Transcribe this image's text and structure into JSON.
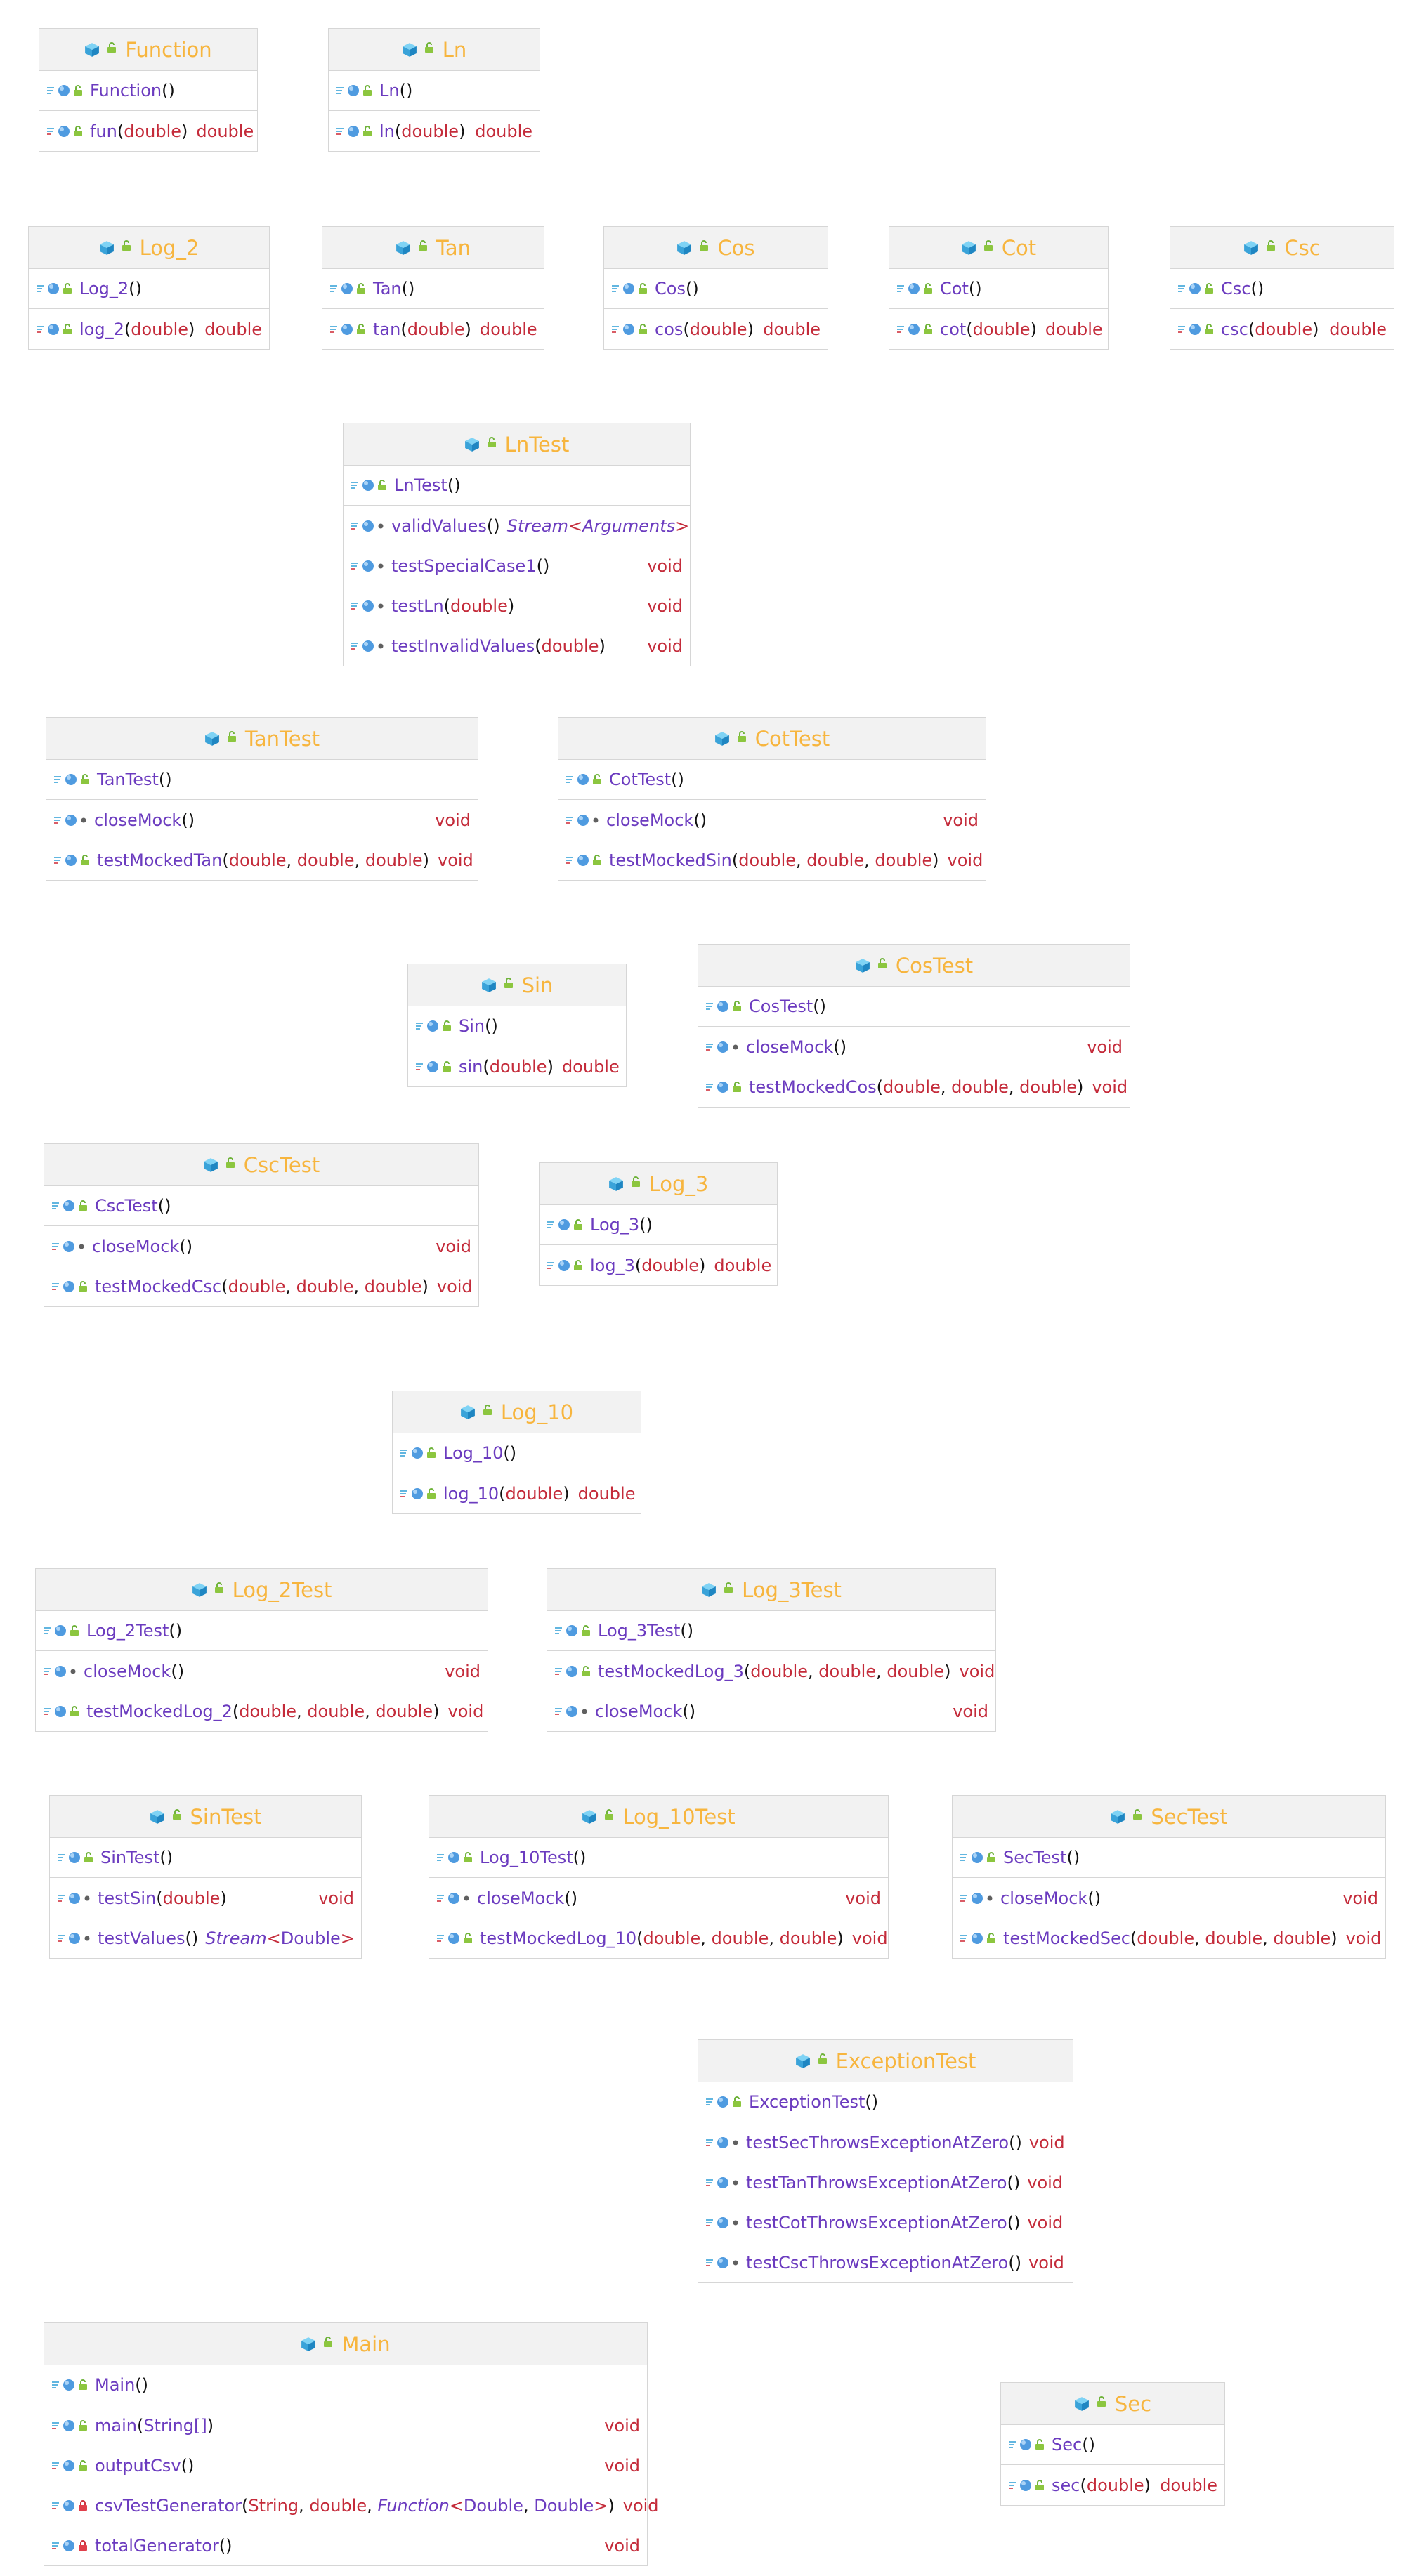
{
  "colors": {
    "class_name": "#f7b53e",
    "method": "#6b3bbf",
    "type": "#c42b3a",
    "header_bg": "#f2f2f2",
    "border": "#d6d6d6"
  },
  "classes": [
    {
      "name": "Function",
      "members": [
        {
          "name": "Function",
          "params": [],
          "ret": "",
          "kind": "ctor",
          "vis": "public"
        },
        {
          "name": "fun",
          "params": [
            {
              "t": "double"
            }
          ],
          "ret": "double",
          "kind": "method",
          "vis": "public"
        }
      ]
    },
    {
      "name": "Ln",
      "members": [
        {
          "name": "Ln",
          "params": [],
          "ret": "",
          "kind": "ctor",
          "vis": "public"
        },
        {
          "name": "ln",
          "params": [
            {
              "t": "double"
            }
          ],
          "ret": "double",
          "kind": "method",
          "vis": "public"
        }
      ]
    },
    {
      "name": "Log_2",
      "members": [
        {
          "name": "Log_2",
          "params": [],
          "ret": "",
          "kind": "ctor",
          "vis": "public"
        },
        {
          "name": "log_2",
          "params": [
            {
              "t": "double"
            }
          ],
          "ret": "double",
          "kind": "method",
          "vis": "public"
        }
      ]
    },
    {
      "name": "Tan",
      "members": [
        {
          "name": "Tan",
          "params": [],
          "ret": "",
          "kind": "ctor",
          "vis": "public"
        },
        {
          "name": "tan",
          "params": [
            {
              "t": "double"
            }
          ],
          "ret": "double",
          "kind": "method",
          "vis": "public"
        }
      ]
    },
    {
      "name": "Cos",
      "members": [
        {
          "name": "Cos",
          "params": [],
          "ret": "",
          "kind": "ctor",
          "vis": "public"
        },
        {
          "name": "cos",
          "params": [
            {
              "t": "double"
            }
          ],
          "ret": "double",
          "kind": "method",
          "vis": "public"
        }
      ]
    },
    {
      "name": "Cot",
      "members": [
        {
          "name": "Cot",
          "params": [],
          "ret": "",
          "kind": "ctor",
          "vis": "public"
        },
        {
          "name": "cot",
          "params": [
            {
              "t": "double"
            }
          ],
          "ret": "double",
          "kind": "method",
          "vis": "public"
        }
      ]
    },
    {
      "name": "Csc",
      "members": [
        {
          "name": "Csc",
          "params": [],
          "ret": "",
          "kind": "ctor",
          "vis": "public"
        },
        {
          "name": "csc",
          "params": [
            {
              "t": "double"
            }
          ],
          "ret": "double",
          "kind": "method",
          "vis": "public"
        }
      ]
    },
    {
      "name": "LnTest",
      "members": [
        {
          "name": "LnTest",
          "params": [],
          "ret": "",
          "kind": "ctor",
          "vis": "public"
        },
        {
          "name": "validValues",
          "params": [],
          "retParts": [
            {
              "t": "Stream",
              "s": "i"
            },
            {
              "t": "<",
              "s": "r"
            },
            {
              "t": "Arguments",
              "s": "i"
            },
            {
              "t": ">",
              "s": "r"
            }
          ],
          "ret": "",
          "inline": true,
          "kind": "method",
          "vis": "package"
        },
        {
          "name": "testSpecialCase1",
          "params": [],
          "ret": "void",
          "kind": "method",
          "vis": "package"
        },
        {
          "name": "testLn",
          "params": [
            {
              "t": "double"
            }
          ],
          "ret": "void",
          "kind": "method",
          "vis": "package"
        },
        {
          "name": "testInvalidValues",
          "params": [
            {
              "t": "double"
            }
          ],
          "ret": "void",
          "kind": "method",
          "vis": "package"
        }
      ]
    },
    {
      "name": "TanTest",
      "members": [
        {
          "name": "TanTest",
          "params": [],
          "ret": "",
          "kind": "ctor",
          "vis": "public"
        },
        {
          "name": "closeMock",
          "params": [],
          "ret": "void",
          "kind": "method",
          "vis": "package"
        },
        {
          "name": "testMockedTan",
          "params": [
            {
              "t": "double"
            },
            {
              "t": "double"
            },
            {
              "t": "double"
            }
          ],
          "ret": "void",
          "kind": "method",
          "vis": "public"
        }
      ]
    },
    {
      "name": "CotTest",
      "members": [
        {
          "name": "CotTest",
          "params": [],
          "ret": "",
          "kind": "ctor",
          "vis": "public"
        },
        {
          "name": "closeMock",
          "params": [],
          "ret": "void",
          "kind": "method",
          "vis": "package"
        },
        {
          "name": "testMockedSin",
          "params": [
            {
              "t": "double"
            },
            {
              "t": "double"
            },
            {
              "t": "double"
            }
          ],
          "ret": "void",
          "kind": "method",
          "vis": "public"
        }
      ]
    },
    {
      "name": "Sin",
      "members": [
        {
          "name": "Sin",
          "params": [],
          "ret": "",
          "kind": "ctor",
          "vis": "public"
        },
        {
          "name": "sin",
          "params": [
            {
              "t": "double"
            }
          ],
          "ret": "double",
          "kind": "method",
          "vis": "public"
        }
      ]
    },
    {
      "name": "CosTest",
      "members": [
        {
          "name": "CosTest",
          "params": [],
          "ret": "",
          "kind": "ctor",
          "vis": "public"
        },
        {
          "name": "closeMock",
          "params": [],
          "ret": "void",
          "kind": "method",
          "vis": "package"
        },
        {
          "name": "testMockedCos",
          "params": [
            {
              "t": "double"
            },
            {
              "t": "double"
            },
            {
              "t": "double"
            }
          ],
          "ret": "void",
          "kind": "method",
          "vis": "public"
        }
      ]
    },
    {
      "name": "CscTest",
      "members": [
        {
          "name": "CscTest",
          "params": [],
          "ret": "",
          "kind": "ctor",
          "vis": "public"
        },
        {
          "name": "closeMock",
          "params": [],
          "ret": "void",
          "kind": "method",
          "vis": "package"
        },
        {
          "name": "testMockedCsc",
          "params": [
            {
              "t": "double"
            },
            {
              "t": "double"
            },
            {
              "t": "double"
            }
          ],
          "ret": "void",
          "kind": "method",
          "vis": "public"
        }
      ]
    },
    {
      "name": "Log_3",
      "members": [
        {
          "name": "Log_3",
          "params": [],
          "ret": "",
          "kind": "ctor",
          "vis": "public"
        },
        {
          "name": "log_3",
          "params": [
            {
              "t": "double"
            }
          ],
          "ret": "double",
          "kind": "method",
          "vis": "public"
        }
      ]
    },
    {
      "name": "Log_10",
      "members": [
        {
          "name": "Log_10",
          "params": [],
          "ret": "",
          "kind": "ctor",
          "vis": "public"
        },
        {
          "name": "log_10",
          "params": [
            {
              "t": "double"
            }
          ],
          "ret": "double",
          "kind": "method",
          "vis": "public"
        }
      ]
    },
    {
      "name": "Log_2Test",
      "members": [
        {
          "name": "Log_2Test",
          "params": [],
          "ret": "",
          "kind": "ctor",
          "vis": "public"
        },
        {
          "name": "closeMock",
          "params": [],
          "ret": "void",
          "kind": "method",
          "vis": "package"
        },
        {
          "name": "testMockedLog_2",
          "params": [
            {
              "t": "double"
            },
            {
              "t": "double"
            },
            {
              "t": "double"
            }
          ],
          "ret": "void",
          "kind": "method",
          "vis": "public"
        }
      ]
    },
    {
      "name": "Log_3Test",
      "members": [
        {
          "name": "Log_3Test",
          "params": [],
          "ret": "",
          "kind": "ctor",
          "vis": "public"
        },
        {
          "name": "testMockedLog_3",
          "params": [
            {
              "t": "double"
            },
            {
              "t": "double"
            },
            {
              "t": "double"
            }
          ],
          "ret": "void",
          "kind": "method",
          "vis": "public"
        },
        {
          "name": "closeMock",
          "params": [],
          "ret": "void",
          "kind": "method",
          "vis": "package"
        }
      ]
    },
    {
      "name": "SinTest",
      "members": [
        {
          "name": "SinTest",
          "params": [],
          "ret": "",
          "kind": "ctor",
          "vis": "public"
        },
        {
          "name": "testSin",
          "params": [
            {
              "t": "double"
            }
          ],
          "ret": "void",
          "kind": "method",
          "vis": "package"
        },
        {
          "name": "testValues",
          "params": [],
          "retParts": [
            {
              "t": "Stream",
              "s": "i"
            },
            {
              "t": "<",
              "s": "r"
            },
            {
              "t": "Double",
              "s": "m"
            },
            {
              "t": ">",
              "s": "r"
            }
          ],
          "ret": "",
          "inline": true,
          "kind": "method",
          "vis": "package"
        }
      ]
    },
    {
      "name": "Log_10Test",
      "members": [
        {
          "name": "Log_10Test",
          "params": [],
          "ret": "",
          "kind": "ctor",
          "vis": "public"
        },
        {
          "name": "closeMock",
          "params": [],
          "ret": "void",
          "kind": "method",
          "vis": "package"
        },
        {
          "name": "testMockedLog_10",
          "params": [
            {
              "t": "double"
            },
            {
              "t": "double"
            },
            {
              "t": "double"
            }
          ],
          "ret": "void",
          "kind": "method",
          "vis": "public"
        }
      ]
    },
    {
      "name": "SecTest",
      "members": [
        {
          "name": "SecTest",
          "params": [],
          "ret": "",
          "kind": "ctor",
          "vis": "public"
        },
        {
          "name": "closeMock",
          "params": [],
          "ret": "void",
          "kind": "method",
          "vis": "package"
        },
        {
          "name": "testMockedSec",
          "params": [
            {
              "t": "double"
            },
            {
              "t": "double"
            },
            {
              "t": "double"
            }
          ],
          "ret": "void",
          "kind": "method",
          "vis": "public"
        }
      ]
    },
    {
      "name": "ExceptionTest",
      "members": [
        {
          "name": "ExceptionTest",
          "params": [],
          "ret": "",
          "kind": "ctor",
          "vis": "public"
        },
        {
          "name": "testSecThrowsExceptionAtZero",
          "params": [],
          "ret": "void",
          "inline": true,
          "kind": "method",
          "vis": "package"
        },
        {
          "name": "testTanThrowsExceptionAtZero",
          "params": [],
          "ret": "void",
          "inline": true,
          "kind": "method",
          "vis": "package"
        },
        {
          "name": "testCotThrowsExceptionAtZero",
          "params": [],
          "ret": "void",
          "inline": true,
          "kind": "method",
          "vis": "package"
        },
        {
          "name": "testCscThrowsExceptionAtZero",
          "params": [],
          "ret": "void",
          "inline": true,
          "kind": "method",
          "vis": "package"
        }
      ]
    },
    {
      "name": "Main",
      "members": [
        {
          "name": "Main",
          "params": [],
          "ret": "",
          "kind": "ctor",
          "vis": "public"
        },
        {
          "name": "main",
          "params": [
            {
              "t": "String[]",
              "plain": true
            }
          ],
          "ret": "void",
          "kind": "method",
          "vis": "public"
        },
        {
          "name": "outputCsv",
          "params": [],
          "ret": "void",
          "kind": "method",
          "vis": "public"
        },
        {
          "name": "csvTestGenerator",
          "params": [
            {
              "t": "String"
            },
            {
              "t": "double"
            },
            {
              "parts": [
                {
                  "t": "Function",
                  "s": "i"
                },
                {
                  "t": "<",
                  "s": "r"
                },
                {
                  "t": "Double",
                  "s": "m"
                },
                {
                  "t": ", ",
                  "s": "p"
                },
                {
                  "t": "Double",
                  "s": "m"
                },
                {
                  "t": ">",
                  "s": "r"
                }
              ]
            }
          ],
          "ret": "void",
          "kind": "method",
          "vis": "private"
        },
        {
          "name": "totalGenerator",
          "params": [],
          "ret": "void",
          "kind": "method",
          "vis": "private"
        }
      ]
    },
    {
      "name": "Sec",
      "members": [
        {
          "name": "Sec",
          "params": [],
          "ret": "",
          "kind": "ctor",
          "vis": "public"
        },
        {
          "name": "sec",
          "params": [
            {
              "t": "double"
            }
          ],
          "ret": "double",
          "kind": "method",
          "vis": "public"
        }
      ]
    }
  ]
}
